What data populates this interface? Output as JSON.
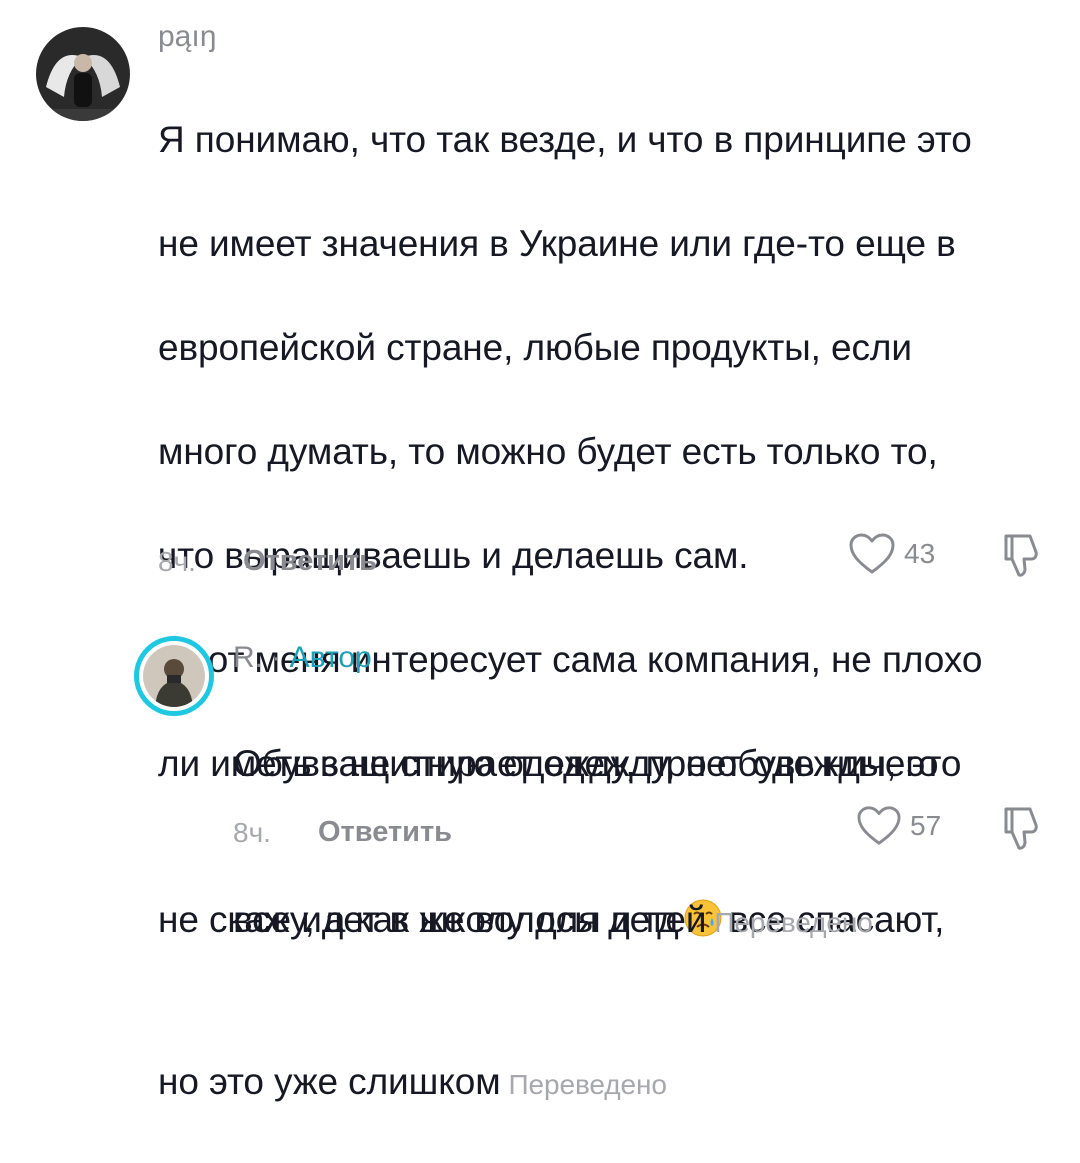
{
  "comments": [
    {
      "username": "pąıŋ",
      "text_lines": [
        "Я понимаю, что так везде, и что в принципе это",
        "не имеет значения в Украине или где-то еще в",
        "европейской стране, любые продукты, если",
        "много думать, то можно будет есть только то,",
        "что выращиваешь и делаешь сам.",
        "а вот меня интересует сама компания, не плохо",
        "ли иметь защитную одежду, про обувь ничего"
      ],
      "line_8_before_emoji": "не скажу, а как же волосы и тд",
      "emoji": "crying-face",
      "line_8_after_emoji": "все спасают,",
      "last_line": "но это уже слишком",
      "translated_label": "Переведено",
      "time": "8ч.",
      "reply_label": "Ответить",
      "likes": "43"
    },
    {
      "username": "R.",
      "separator": " · ",
      "author_label": "Автор",
      "text_line_1": "Обувь не стирает одежду, нет одежды, это",
      "text_line_2": "все идет в школу для детей",
      "translated_label": "Переведено",
      "time": "8ч.",
      "reply_label": "Ответить",
      "likes": "57"
    }
  ],
  "colors": {
    "text": "#161823",
    "muted": "#8a8b91",
    "author_accent": "#1e9fb6",
    "story_ring": "#1ec8e0"
  }
}
